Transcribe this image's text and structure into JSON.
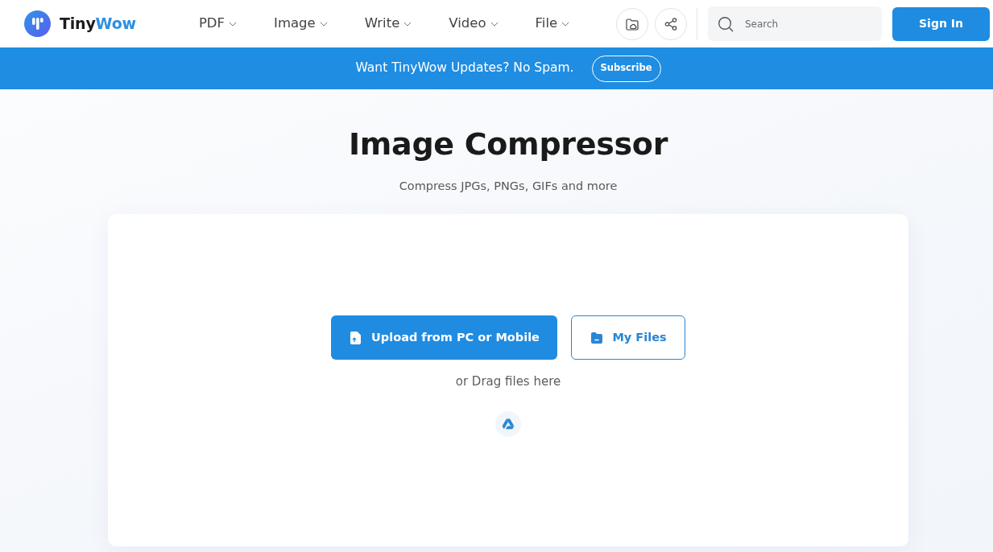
{
  "header": {
    "logo": {
      "name": "Tiny",
      "name_accent": "Wow"
    },
    "nav": [
      {
        "label": "PDF"
      },
      {
        "label": "Image"
      },
      {
        "label": "Write"
      },
      {
        "label": "Video"
      },
      {
        "label": "File"
      }
    ],
    "search": {
      "placeholder": "Search"
    },
    "sign_in": "Sign In"
  },
  "banner": {
    "text": "Want TinyWow Updates? No Spam.",
    "button": "Subscribe"
  },
  "page": {
    "title": "Image Compressor",
    "subtitle": "Compress JPGs, PNGs, GIFs and more"
  },
  "upload": {
    "primary_button": "Upload from PC or Mobile",
    "secondary_button": "My Files",
    "drop_hint": "or Drag files here"
  }
}
